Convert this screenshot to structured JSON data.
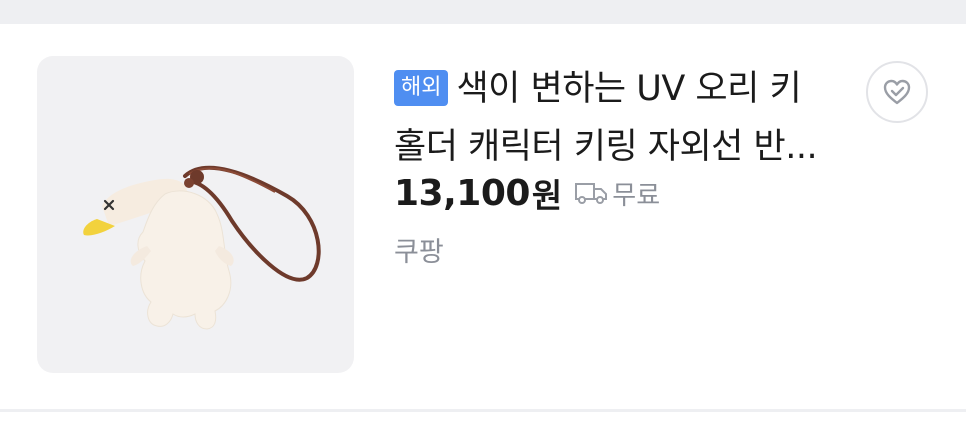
{
  "product": {
    "badge": "해외",
    "title_line1": "색이 변하는 UV 오리 키",
    "title_line2": "홀더 캐릭터 키링 자외선 반...",
    "price": "13,100",
    "currency": "원",
    "shipping": "무료",
    "store": "쿠팡",
    "image_icon": "duck-keyring-image"
  },
  "actions": {
    "wishlist_icon": "heart-check-icon"
  },
  "colors": {
    "badge": "#4f8ef1",
    "muted_text": "#8b8f98",
    "thumbnail_bg": "#f1f1f3"
  }
}
